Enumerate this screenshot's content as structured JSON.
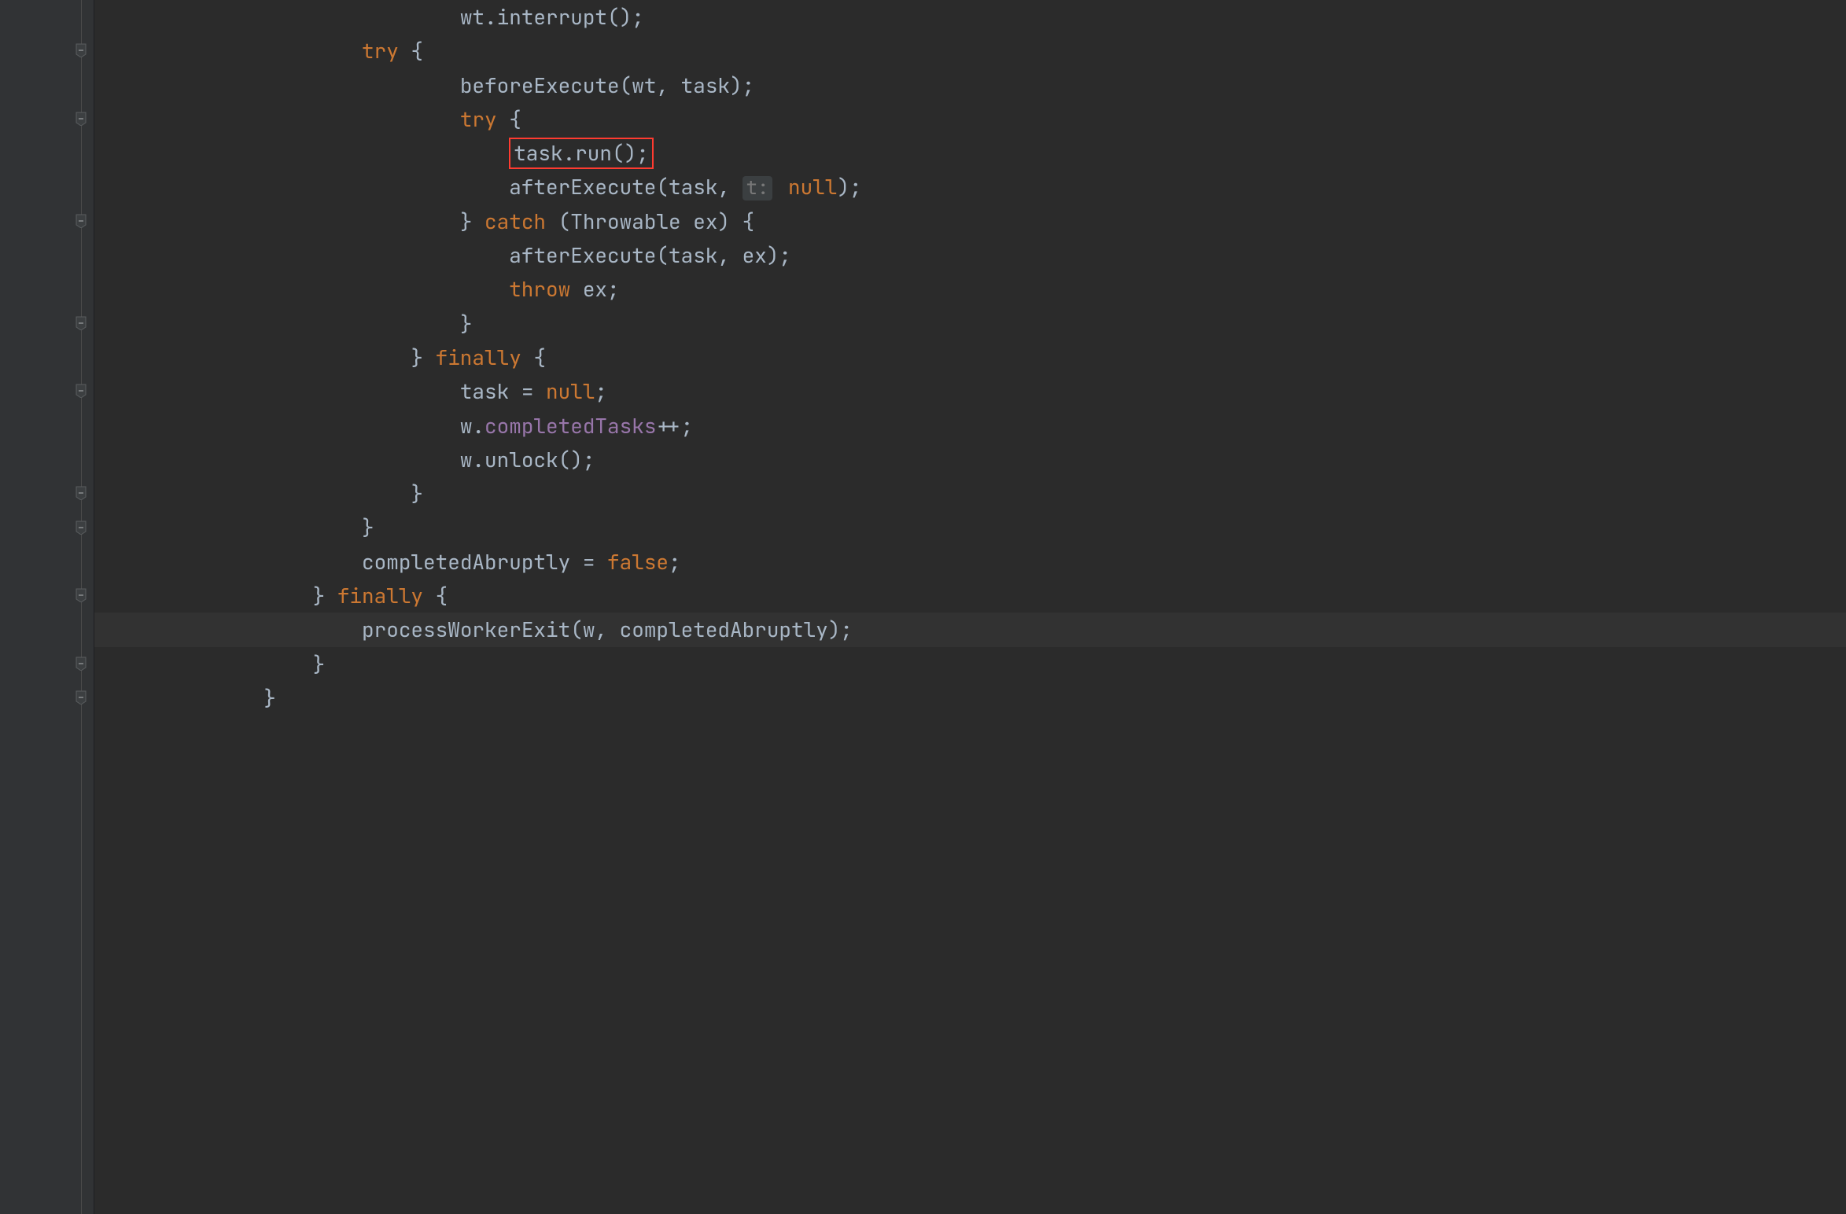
{
  "colors": {
    "background": "#2b2b2b",
    "gutter": "#313335",
    "text": "#a9b7c6",
    "keyword": "#cc7832",
    "field": "#9876aa",
    "highlight": "#323232",
    "annotation_red": "#ff3b30"
  },
  "fold_icons_at_lines": [
    1,
    3,
    6,
    9,
    11,
    14,
    15,
    17,
    19,
    20
  ],
  "highlighted_line_index": 18,
  "red_box_on_line_index": 4,
  "arrows": [
    {
      "from": "task.run()",
      "to": "task = null;"
    },
    {
      "from": "task = null;",
      "to": "processWorkerExit"
    }
  ],
  "lines": [
    {
      "indent": 7,
      "tokens": [
        {
          "t": "wt.interrupt();",
          "c": "id"
        }
      ]
    },
    {
      "indent": 5,
      "tokens": [
        {
          "t": "try",
          "c": "kw"
        },
        {
          "t": " {",
          "c": "id"
        }
      ]
    },
    {
      "indent": 7,
      "tokens": [
        {
          "t": "beforeExecute(wt, task);",
          "c": "id"
        }
      ]
    },
    {
      "indent": 7,
      "tokens": [
        {
          "t": "try",
          "c": "kw"
        },
        {
          "t": " {",
          "c": "id"
        }
      ]
    },
    {
      "indent": 8,
      "tokens": [
        {
          "t": "task.run();",
          "c": "id"
        }
      ],
      "boxed": true
    },
    {
      "indent": 8,
      "tokens": [
        {
          "t": "afterExecute(task, ",
          "c": "id"
        },
        {
          "t": "t:",
          "c": "param-hint"
        },
        {
          "t": " ",
          "c": "id"
        },
        {
          "t": "null",
          "c": "num-null"
        },
        {
          "t": ");",
          "c": "id"
        }
      ]
    },
    {
      "indent": 7,
      "tokens": [
        {
          "t": "} ",
          "c": "id"
        },
        {
          "t": "catch",
          "c": "kw"
        },
        {
          "t": " (Throwable ex) {",
          "c": "id"
        }
      ]
    },
    {
      "indent": 8,
      "tokens": [
        {
          "t": "afterExecute(task, ex);",
          "c": "id"
        }
      ]
    },
    {
      "indent": 8,
      "tokens": [
        {
          "t": "throw",
          "c": "kw"
        },
        {
          "t": " ex;",
          "c": "id"
        }
      ]
    },
    {
      "indent": 7,
      "tokens": [
        {
          "t": "}",
          "c": "id"
        }
      ]
    },
    {
      "indent": 6,
      "tokens": [
        {
          "t": "} ",
          "c": "id"
        },
        {
          "t": "finally",
          "c": "kw"
        },
        {
          "t": " {",
          "c": "id"
        }
      ]
    },
    {
      "indent": 7,
      "tokens": [
        {
          "t": "task = ",
          "c": "id"
        },
        {
          "t": "null",
          "c": "num-null"
        },
        {
          "t": ";",
          "c": "id"
        }
      ]
    },
    {
      "indent": 7,
      "tokens": [
        {
          "t": "w.",
          "c": "id"
        },
        {
          "t": "completedTasks",
          "c": "field"
        },
        {
          "t": "++;",
          "c": "id"
        }
      ]
    },
    {
      "indent": 7,
      "tokens": [
        {
          "t": "w.unlock();",
          "c": "id"
        }
      ]
    },
    {
      "indent": 6,
      "tokens": [
        {
          "t": "}",
          "c": "id"
        }
      ]
    },
    {
      "indent": 5,
      "tokens": [
        {
          "t": "}",
          "c": "id"
        }
      ]
    },
    {
      "indent": 5,
      "tokens": [
        {
          "t": "completedAbruptly = ",
          "c": "id"
        },
        {
          "t": "false",
          "c": "num-null"
        },
        {
          "t": ";",
          "c": "id"
        }
      ]
    },
    {
      "indent": 4,
      "tokens": [
        {
          "t": "} ",
          "c": "id"
        },
        {
          "t": "finally",
          "c": "kw"
        },
        {
          "t": " {",
          "c": "id"
        }
      ]
    },
    {
      "indent": 5,
      "tokens": [
        {
          "t": "processWorkerExit(w, completedAbruptly);",
          "c": "id"
        }
      ]
    },
    {
      "indent": 4,
      "tokens": [
        {
          "t": "}",
          "c": "id"
        }
      ]
    },
    {
      "indent": 3,
      "tokens": [
        {
          "t": "}",
          "c": "id"
        }
      ]
    }
  ]
}
